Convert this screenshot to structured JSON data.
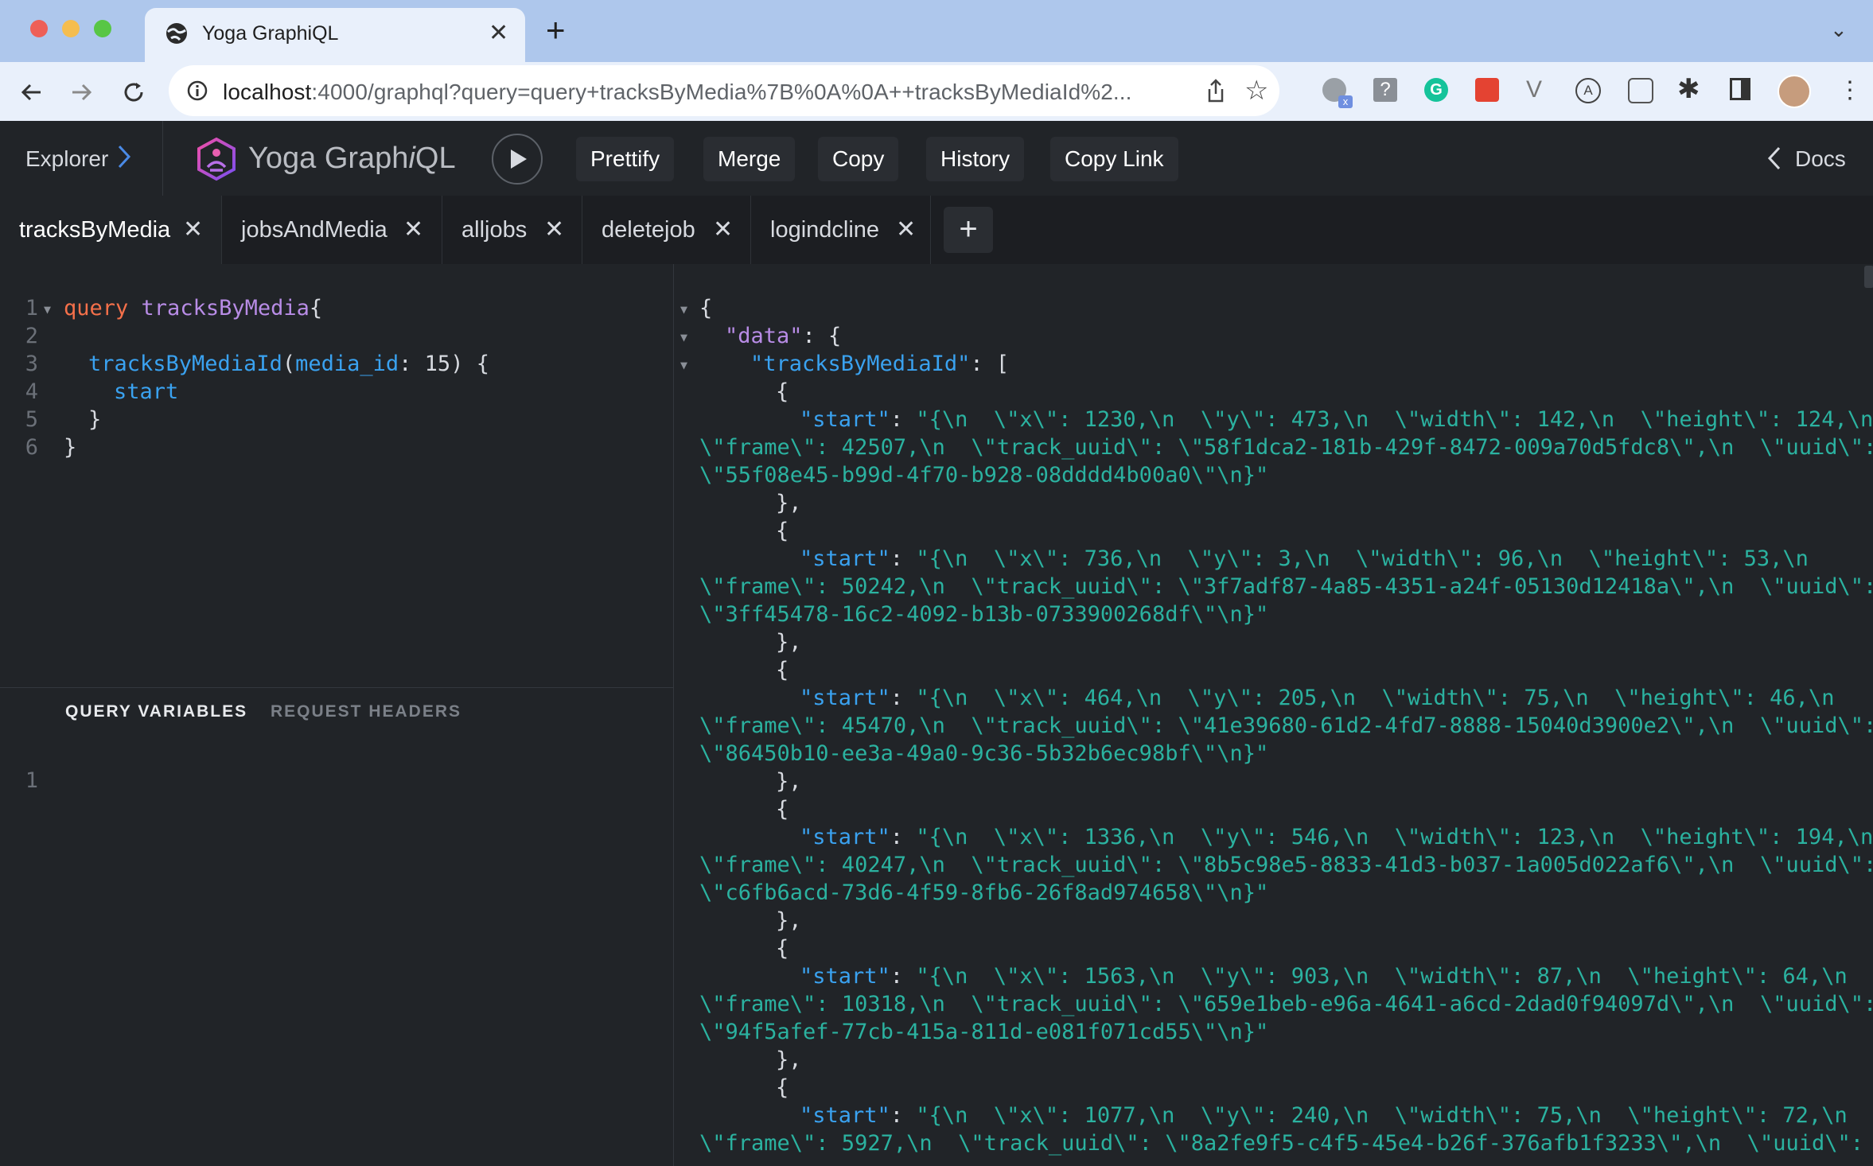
{
  "browser": {
    "tab_title": "Yoga GraphiQL",
    "url_host": "localhost",
    "url_rest": ":4000/graphql?query=query+tracksByMedia%7B%0A%0A++tracksByMediaId%2...",
    "extension_badge": "x"
  },
  "header": {
    "explorer_label": "Explorer",
    "logo_text_1": "Yoga Graph",
    "logo_text_i": "i",
    "logo_text_2": "QL",
    "buttons": {
      "prettify": "Prettify",
      "merge": "Merge",
      "copy": "Copy",
      "history": "History",
      "copy_link": "Copy Link"
    },
    "docs_label": "Docs"
  },
  "tabs": [
    {
      "label": "tracksByMedia",
      "active": true
    },
    {
      "label": "jobsAndMedia"
    },
    {
      "label": "alljobs"
    },
    {
      "label": "deletejob"
    },
    {
      "label": "logindcline"
    }
  ],
  "query_editor": {
    "line_numbers": [
      "1",
      "2",
      "3",
      "4",
      "5",
      "6"
    ],
    "keyword": "query",
    "operation_name": "tracksByMedia",
    "field": "tracksByMediaId",
    "arg_name": "media_id",
    "arg_value": "15",
    "subfield": "start"
  },
  "variables_bar": {
    "query_variables": "QUERY VARIABLES",
    "request_headers": "REQUEST HEADERS"
  },
  "variables_editor": {
    "line_number": "1"
  },
  "result": {
    "data_key": "\"data\"",
    "tracks_key": "\"tracksByMediaId\"",
    "start_key": "\"start\"",
    "items": [
      {
        "l1": "\"{\\n  \\\"x\\\": 1230,\\n  \\\"y\\\": 473,\\n  \\\"width\\\": 142,\\n  \\\"height\\\": 124,\\n",
        "l2": "\\\"frame\\\": 42507,\\n  \\\"track_uuid\\\": \\\"58f1dca2-181b-429f-8472-009a70d5fdc8\\\",\\n  \\\"uuid\\\":",
        "l3": "\\\"55f08e45-b99d-4f70-b928-08dddd4b00a0\\\"\\n}\""
      },
      {
        "l1": "\"{\\n  \\\"x\\\": 736,\\n  \\\"y\\\": 3,\\n  \\\"width\\\": 96,\\n  \\\"height\\\": 53,\\n",
        "l2": "\\\"frame\\\": 50242,\\n  \\\"track_uuid\\\": \\\"3f7adf87-4a85-4351-a24f-05130d12418a\\\",\\n  \\\"uuid\\\":",
        "l3": "\\\"3ff45478-16c2-4092-b13b-0733900268df\\\"\\n}\""
      },
      {
        "l1": "\"{\\n  \\\"x\\\": 464,\\n  \\\"y\\\": 205,\\n  \\\"width\\\": 75,\\n  \\\"height\\\": 46,\\n",
        "l2": "\\\"frame\\\": 45470,\\n  \\\"track_uuid\\\": \\\"41e39680-61d2-4fd7-8888-15040d3900e2\\\",\\n  \\\"uuid\\\":",
        "l3": "\\\"86450b10-ee3a-49a0-9c36-5b32b6ec98bf\\\"\\n}\""
      },
      {
        "l1": "\"{\\n  \\\"x\\\": 1336,\\n  \\\"y\\\": 546,\\n  \\\"width\\\": 123,\\n  \\\"height\\\": 194,\\n",
        "l2": "\\\"frame\\\": 40247,\\n  \\\"track_uuid\\\": \\\"8b5c98e5-8833-41d3-b037-1a005d022af6\\\",\\n  \\\"uuid\\\":",
        "l3": "\\\"c6fb6acd-73d6-4f59-8fb6-26f8ad974658\\\"\\n}\""
      },
      {
        "l1": "\"{\\n  \\\"x\\\": 1563,\\n  \\\"y\\\": 903,\\n  \\\"width\\\": 87,\\n  \\\"height\\\": 64,\\n",
        "l2": "\\\"frame\\\": 10318,\\n  \\\"track_uuid\\\": \\\"659e1beb-e96a-4641-a6cd-2dad0f94097d\\\",\\n  \\\"uuid\\\":",
        "l3": "\\\"94f5afef-77cb-415a-811d-e081f071cd55\\\"\\n}\""
      },
      {
        "l1": "\"{\\n  \\\"x\\\": 1077,\\n  \\\"y\\\": 240,\\n  \\\"width\\\": 75,\\n  \\\"height\\\": 72,\\n",
        "l2": "\\\"frame\\\": 5927,\\n  \\\"track_uuid\\\": \\\"8a2fe9f5-c4f5-45e4-b26f-376afb1f3233\\\",\\n  \\\"uuid\\\":"
      }
    ]
  }
}
